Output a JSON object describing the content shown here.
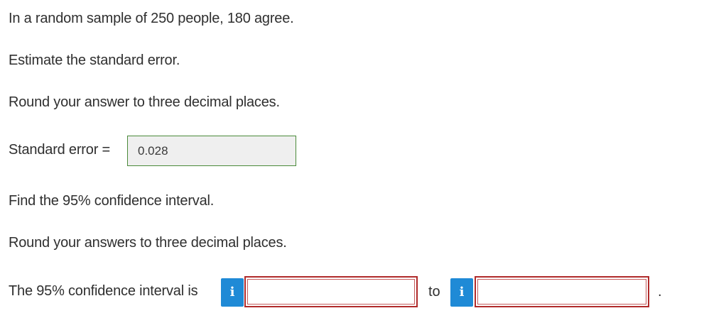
{
  "question": {
    "sample_text": "In a random sample of 250 people, 180 agree.",
    "estimate_prompt": "Estimate the standard error.",
    "round_instruction_1": "Round your answer to three decimal places.",
    "ci_prompt": "Find the 95% confidence interval.",
    "round_instruction_2": "Round your answers to three decimal places."
  },
  "standard_error": {
    "label": "Standard error =",
    "value": "0.028"
  },
  "confidence_interval": {
    "label": "The 95% confidence interval is",
    "lower_value": "",
    "upper_value": "",
    "separator": "to",
    "terminator": ".",
    "info_icon_glyph": "i"
  },
  "icons": {
    "info": "info-icon"
  },
  "colors": {
    "info_button": "#1f8ad6",
    "input_error_border": "#b02a2a",
    "input_ok_border": "#4a8a3a",
    "input_filled_bg": "#efefef"
  }
}
